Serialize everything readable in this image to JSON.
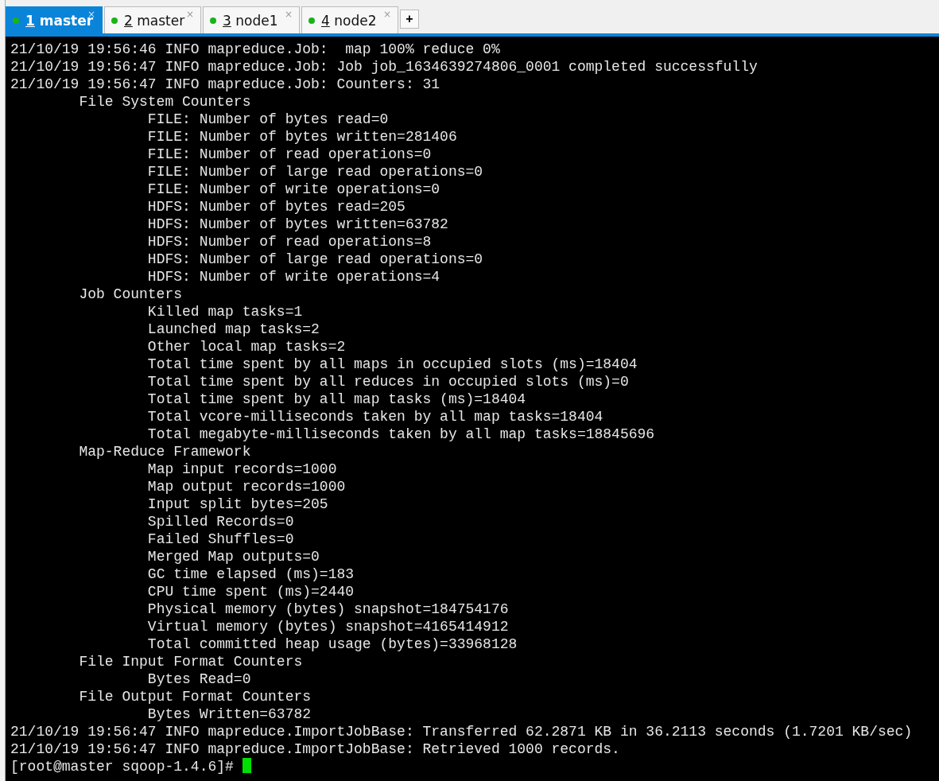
{
  "tabs": [
    {
      "number": "1",
      "name": "master",
      "selected": true,
      "close": "×"
    },
    {
      "number": "2",
      "name": "master",
      "selected": false,
      "close": "×"
    },
    {
      "number": "3",
      "name": "node1",
      "selected": false,
      "close": "×"
    },
    {
      "number": "4",
      "name": "node2",
      "selected": false,
      "close": "×"
    }
  ],
  "new_tab": "+",
  "terminal": {
    "lines": [
      {
        "kind": "log",
        "text": "21/10/19 19:56:46 INFO mapreduce.Job:  map 100% reduce 0%"
      },
      {
        "kind": "log",
        "text": "21/10/19 19:56:47 INFO mapreduce.Job: Job job_1634639274806_0001 completed successfully"
      },
      {
        "kind": "log",
        "text": "21/10/19 19:56:47 INFO mapreduce.Job: Counters: 31"
      },
      {
        "kind": "group",
        "text": "File System Counters"
      },
      {
        "kind": "counter",
        "text": "FILE: Number of bytes read=0"
      },
      {
        "kind": "counter",
        "text": "FILE: Number of bytes written=281406"
      },
      {
        "kind": "counter",
        "text": "FILE: Number of read operations=0"
      },
      {
        "kind": "counter",
        "text": "FILE: Number of large read operations=0"
      },
      {
        "kind": "counter",
        "text": "FILE: Number of write operations=0"
      },
      {
        "kind": "counter",
        "text": "HDFS: Number of bytes read=205"
      },
      {
        "kind": "counter",
        "text": "HDFS: Number of bytes written=63782"
      },
      {
        "kind": "counter",
        "text": "HDFS: Number of read operations=8"
      },
      {
        "kind": "counter",
        "text": "HDFS: Number of large read operations=0"
      },
      {
        "kind": "counter",
        "text": "HDFS: Number of write operations=4"
      },
      {
        "kind": "group",
        "text": "Job Counters"
      },
      {
        "kind": "counter",
        "text": "Killed map tasks=1"
      },
      {
        "kind": "counter",
        "text": "Launched map tasks=2"
      },
      {
        "kind": "counter",
        "text": "Other local map tasks=2"
      },
      {
        "kind": "counter",
        "text": "Total time spent by all maps in occupied slots (ms)=18404"
      },
      {
        "kind": "counter",
        "text": "Total time spent by all reduces in occupied slots (ms)=0"
      },
      {
        "kind": "counter",
        "text": "Total time spent by all map tasks (ms)=18404"
      },
      {
        "kind": "counter",
        "text": "Total vcore-milliseconds taken by all map tasks=18404"
      },
      {
        "kind": "counter",
        "text": "Total megabyte-milliseconds taken by all map tasks=18845696"
      },
      {
        "kind": "group",
        "text": "Map-Reduce Framework"
      },
      {
        "kind": "counter",
        "text": "Map input records=1000"
      },
      {
        "kind": "counter",
        "text": "Map output records=1000"
      },
      {
        "kind": "counter",
        "text": "Input split bytes=205"
      },
      {
        "kind": "counter",
        "text": "Spilled Records=0"
      },
      {
        "kind": "counter",
        "text": "Failed Shuffles=0"
      },
      {
        "kind": "counter",
        "text": "Merged Map outputs=0"
      },
      {
        "kind": "counter",
        "text": "GC time elapsed (ms)=183"
      },
      {
        "kind": "counter",
        "text": "CPU time spent (ms)=2440"
      },
      {
        "kind": "counter",
        "text": "Physical memory (bytes) snapshot=184754176"
      },
      {
        "kind": "counter",
        "text": "Virtual memory (bytes) snapshot=4165414912"
      },
      {
        "kind": "counter",
        "text": "Total committed heap usage (bytes)=33968128"
      },
      {
        "kind": "group",
        "text": "File Input Format Counters"
      },
      {
        "kind": "counter",
        "text": "Bytes Read=0"
      },
      {
        "kind": "group",
        "text": "File Output Format Counters"
      },
      {
        "kind": "counter",
        "text": "Bytes Written=63782"
      },
      {
        "kind": "log",
        "text": "21/10/19 19:56:47 INFO mapreduce.ImportJobBase: Transferred 62.2871 KB in 36.2113 seconds (1.7201 KB/sec)"
      },
      {
        "kind": "log",
        "text": "21/10/19 19:56:47 INFO mapreduce.ImportJobBase: Retrieved 1000 records."
      }
    ],
    "prompt": "[root@master sqoop-1.4.6]#"
  }
}
